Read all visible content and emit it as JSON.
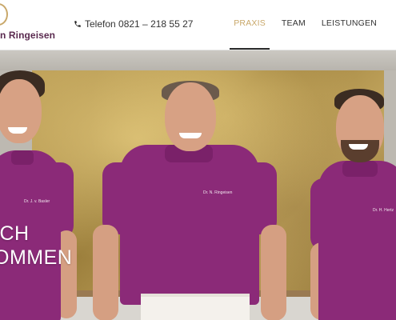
{
  "header": {
    "logo_text": "n Ringeisen",
    "phone": {
      "label": "Telefon 0821 – 218 55 27",
      "icon": "phone-icon"
    },
    "nav": [
      {
        "label": "PRAXIS",
        "active": true
      },
      {
        "label": "TEAM",
        "active": false
      },
      {
        "label": "LEISTUNGEN",
        "active": false
      }
    ]
  },
  "hero": {
    "headline_line1": "ICH",
    "headline_line2": "OMMEN",
    "people": [
      {
        "tag": "Dr. J. v. Basler"
      },
      {
        "tag": "Dr. N. Ringeisen"
      },
      {
        "tag": "Dr. H. Hertz"
      }
    ]
  },
  "colors": {
    "accent_gold": "#c9a86a",
    "brand_purple": "#5a2a4f",
    "shirt_purple": "#8b2a78"
  }
}
